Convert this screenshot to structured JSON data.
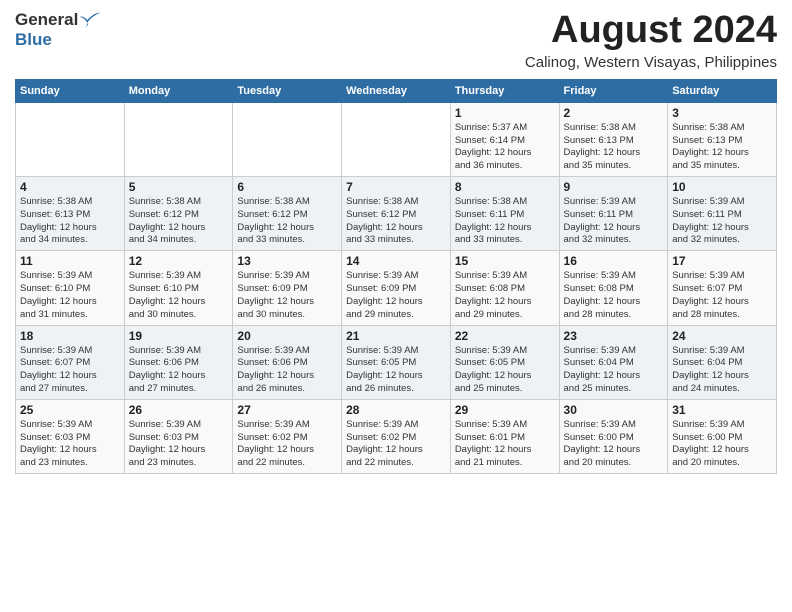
{
  "header": {
    "logo_general": "General",
    "logo_blue": "Blue",
    "title": "August 2024",
    "subtitle": "Calinog, Western Visayas, Philippines"
  },
  "calendar": {
    "days_of_week": [
      "Sunday",
      "Monday",
      "Tuesday",
      "Wednesday",
      "Thursday",
      "Friday",
      "Saturday"
    ],
    "weeks": [
      [
        {
          "day": "",
          "info": ""
        },
        {
          "day": "",
          "info": ""
        },
        {
          "day": "",
          "info": ""
        },
        {
          "day": "",
          "info": ""
        },
        {
          "day": "1",
          "info": "Sunrise: 5:37 AM\nSunset: 6:14 PM\nDaylight: 12 hours\nand 36 minutes."
        },
        {
          "day": "2",
          "info": "Sunrise: 5:38 AM\nSunset: 6:13 PM\nDaylight: 12 hours\nand 35 minutes."
        },
        {
          "day": "3",
          "info": "Sunrise: 5:38 AM\nSunset: 6:13 PM\nDaylight: 12 hours\nand 35 minutes."
        }
      ],
      [
        {
          "day": "4",
          "info": "Sunrise: 5:38 AM\nSunset: 6:13 PM\nDaylight: 12 hours\nand 34 minutes."
        },
        {
          "day": "5",
          "info": "Sunrise: 5:38 AM\nSunset: 6:12 PM\nDaylight: 12 hours\nand 34 minutes."
        },
        {
          "day": "6",
          "info": "Sunrise: 5:38 AM\nSunset: 6:12 PM\nDaylight: 12 hours\nand 33 minutes."
        },
        {
          "day": "7",
          "info": "Sunrise: 5:38 AM\nSunset: 6:12 PM\nDaylight: 12 hours\nand 33 minutes."
        },
        {
          "day": "8",
          "info": "Sunrise: 5:38 AM\nSunset: 6:11 PM\nDaylight: 12 hours\nand 33 minutes."
        },
        {
          "day": "9",
          "info": "Sunrise: 5:39 AM\nSunset: 6:11 PM\nDaylight: 12 hours\nand 32 minutes."
        },
        {
          "day": "10",
          "info": "Sunrise: 5:39 AM\nSunset: 6:11 PM\nDaylight: 12 hours\nand 32 minutes."
        }
      ],
      [
        {
          "day": "11",
          "info": "Sunrise: 5:39 AM\nSunset: 6:10 PM\nDaylight: 12 hours\nand 31 minutes."
        },
        {
          "day": "12",
          "info": "Sunrise: 5:39 AM\nSunset: 6:10 PM\nDaylight: 12 hours\nand 30 minutes."
        },
        {
          "day": "13",
          "info": "Sunrise: 5:39 AM\nSunset: 6:09 PM\nDaylight: 12 hours\nand 30 minutes."
        },
        {
          "day": "14",
          "info": "Sunrise: 5:39 AM\nSunset: 6:09 PM\nDaylight: 12 hours\nand 29 minutes."
        },
        {
          "day": "15",
          "info": "Sunrise: 5:39 AM\nSunset: 6:08 PM\nDaylight: 12 hours\nand 29 minutes."
        },
        {
          "day": "16",
          "info": "Sunrise: 5:39 AM\nSunset: 6:08 PM\nDaylight: 12 hours\nand 28 minutes."
        },
        {
          "day": "17",
          "info": "Sunrise: 5:39 AM\nSunset: 6:07 PM\nDaylight: 12 hours\nand 28 minutes."
        }
      ],
      [
        {
          "day": "18",
          "info": "Sunrise: 5:39 AM\nSunset: 6:07 PM\nDaylight: 12 hours\nand 27 minutes."
        },
        {
          "day": "19",
          "info": "Sunrise: 5:39 AM\nSunset: 6:06 PM\nDaylight: 12 hours\nand 27 minutes."
        },
        {
          "day": "20",
          "info": "Sunrise: 5:39 AM\nSunset: 6:06 PM\nDaylight: 12 hours\nand 26 minutes."
        },
        {
          "day": "21",
          "info": "Sunrise: 5:39 AM\nSunset: 6:05 PM\nDaylight: 12 hours\nand 26 minutes."
        },
        {
          "day": "22",
          "info": "Sunrise: 5:39 AM\nSunset: 6:05 PM\nDaylight: 12 hours\nand 25 minutes."
        },
        {
          "day": "23",
          "info": "Sunrise: 5:39 AM\nSunset: 6:04 PM\nDaylight: 12 hours\nand 25 minutes."
        },
        {
          "day": "24",
          "info": "Sunrise: 5:39 AM\nSunset: 6:04 PM\nDaylight: 12 hours\nand 24 minutes."
        }
      ],
      [
        {
          "day": "25",
          "info": "Sunrise: 5:39 AM\nSunset: 6:03 PM\nDaylight: 12 hours\nand 23 minutes."
        },
        {
          "day": "26",
          "info": "Sunrise: 5:39 AM\nSunset: 6:03 PM\nDaylight: 12 hours\nand 23 minutes."
        },
        {
          "day": "27",
          "info": "Sunrise: 5:39 AM\nSunset: 6:02 PM\nDaylight: 12 hours\nand 22 minutes."
        },
        {
          "day": "28",
          "info": "Sunrise: 5:39 AM\nSunset: 6:02 PM\nDaylight: 12 hours\nand 22 minutes."
        },
        {
          "day": "29",
          "info": "Sunrise: 5:39 AM\nSunset: 6:01 PM\nDaylight: 12 hours\nand 21 minutes."
        },
        {
          "day": "30",
          "info": "Sunrise: 5:39 AM\nSunset: 6:00 PM\nDaylight: 12 hours\nand 20 minutes."
        },
        {
          "day": "31",
          "info": "Sunrise: 5:39 AM\nSunset: 6:00 PM\nDaylight: 12 hours\nand 20 minutes."
        }
      ]
    ]
  }
}
